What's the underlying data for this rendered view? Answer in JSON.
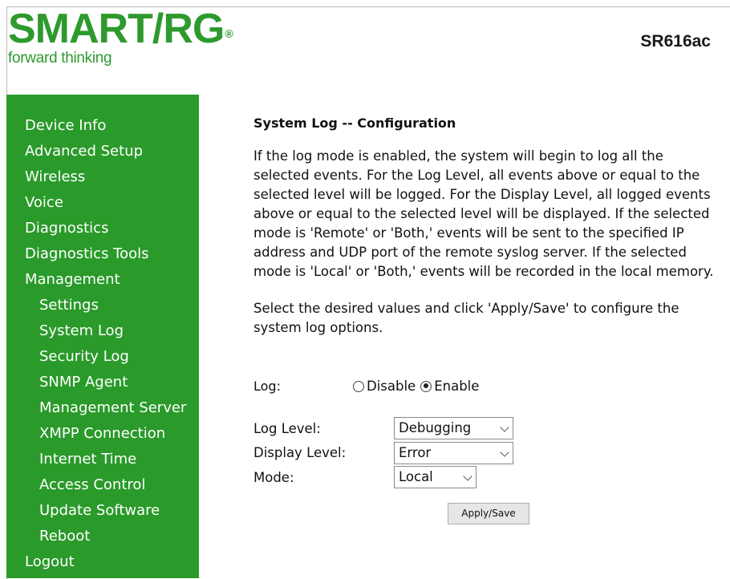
{
  "brand": {
    "logo_text": "SMART/RG",
    "logo_reg": "®",
    "tagline": "forward thinking",
    "brand_color": "#2e9a2e",
    "model": "SR616ac"
  },
  "sidebar": {
    "bg_color": "#2a9a2a",
    "items": [
      {
        "label": "Device Info"
      },
      {
        "label": "Advanced Setup"
      },
      {
        "label": "Wireless"
      },
      {
        "label": "Voice"
      },
      {
        "label": "Diagnostics"
      },
      {
        "label": "Diagnostics Tools"
      },
      {
        "label": "Management"
      },
      {
        "label": "Settings"
      },
      {
        "label": "System Log"
      },
      {
        "label": "Security Log"
      },
      {
        "label": "SNMP Agent"
      },
      {
        "label": "Management Server"
      },
      {
        "label": "XMPP Connection"
      },
      {
        "label": "Internet Time"
      },
      {
        "label": "Access Control"
      },
      {
        "label": "Update Software"
      },
      {
        "label": "Reboot"
      },
      {
        "label": "Logout"
      }
    ]
  },
  "main": {
    "title": "System Log -- Configuration",
    "description": "If the log mode is enabled, the system will begin to log all the selected events. For the Log Level, all events above or equal to the selected level will be logged. For the Display Level, all logged events above or equal to the selected level will be displayed. If the selected mode is 'Remote' or 'Both,' events will be sent to the specified IP address and UDP port of the remote syslog server. If the selected mode is 'Local' or 'Both,' events will be recorded in the local memory.",
    "instructions": "Select the desired values and click 'Apply/Save' to configure the system log options.",
    "log": {
      "label": "Log:",
      "options": [
        "Disable",
        "Enable"
      ],
      "selected": "Enable"
    },
    "log_level": {
      "label": "Log Level:",
      "value": "Debugging"
    },
    "display_level": {
      "label": "Display Level:",
      "value": "Error"
    },
    "mode": {
      "label": "Mode:",
      "value": "Local"
    },
    "apply_label": "Apply/Save"
  }
}
